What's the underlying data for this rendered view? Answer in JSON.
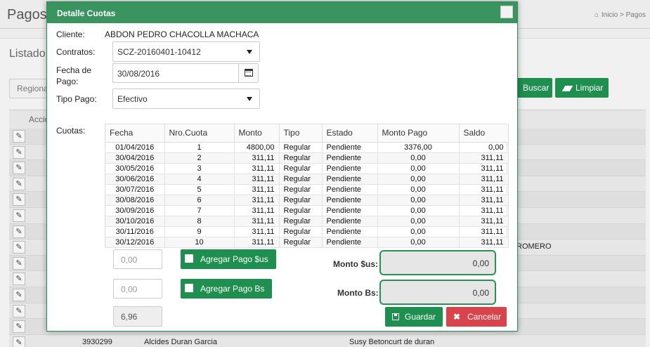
{
  "background": {
    "title": "Pagos",
    "breadcrumb": {
      "home": "Inicio",
      "sep": ">",
      "current": "Pagos"
    },
    "listado": "Listado",
    "region_filter": "Regional",
    "search_label": "Buscar",
    "clear_label": "Limpiar",
    "actions_header": "Acciones",
    "row_right_text": "ROMERO",
    "last_row": {
      "code": "3930299",
      "name": "Alcides Duran Garcia",
      "agent": "Susy Betoncurt de duran"
    }
  },
  "modal": {
    "title": "Detalle Cuotas",
    "client_label": "Cliente:",
    "client_value": "ABDON PEDRO CHACOLLA MACHACA",
    "contract_label": "Contratos:",
    "contract_value": "SCZ-20160401-10412",
    "date_label": "Fecha de Pago:",
    "date_value": "30/08/2016",
    "pay_type_label": "Tipo Pago:",
    "pay_type_value": "Efectivo",
    "quotas_label": "Cuotas:",
    "columns": [
      "Fecha",
      "Nro.Cuota",
      "Monto",
      "Tipo",
      "Estado",
      "Monto Pago",
      "Saldo"
    ],
    "rows": [
      [
        "01/04/2016",
        "1",
        "4800,00",
        "Regular",
        "Pendiente",
        "3376,00",
        "0,00"
      ],
      [
        "30/04/2016",
        "2",
        "311,11",
        "Regular",
        "Pendiente",
        "0,00",
        "311,11"
      ],
      [
        "30/05/2016",
        "3",
        "311,11",
        "Regular",
        "Pendiente",
        "0,00",
        "311,11"
      ],
      [
        "30/06/2016",
        "4",
        "311,11",
        "Regular",
        "Pendiente",
        "0,00",
        "311,11"
      ],
      [
        "30/07/2016",
        "5",
        "311,11",
        "Regular",
        "Pendiente",
        "0,00",
        "311,11"
      ],
      [
        "30/08/2016",
        "6",
        "311,11",
        "Regular",
        "Pendiente",
        "0,00",
        "311,11"
      ],
      [
        "30/09/2016",
        "7",
        "311,11",
        "Regular",
        "Pendiente",
        "0,00",
        "311,11"
      ],
      [
        "30/10/2016",
        "8",
        "311,11",
        "Regular",
        "Pendiente",
        "0,00",
        "311,11"
      ],
      [
        "30/11/2016",
        "9",
        "311,11",
        "Regular",
        "Pendiente",
        "0,00",
        "311,11"
      ],
      [
        "30/12/2016",
        "10",
        "311,11",
        "Regular",
        "Pendiente",
        "0,00",
        "311,11"
      ]
    ],
    "usd_input_placeholder": "0,00",
    "add_usd_label": "Agregar Pago $us",
    "bs_input_placeholder": "0,00",
    "add_bs_label": "Agregar Pago Bs",
    "exchange_rate": "6,96",
    "monto_usd_label": "Monto $us:",
    "monto_usd_value": "0,00",
    "monto_bs_label": "Monto Bs:",
    "monto_bs_value": "0,00",
    "save_label": "Guardar",
    "cancel_label": "Cancelar"
  },
  "colors": {
    "brand_green": "#1e8f4e",
    "header_green": "#3a9460",
    "danger_red": "#d9444c"
  },
  "icons": [
    "home-icon",
    "pencil-icon",
    "calendar-icon",
    "checkbox-icon",
    "save-icon",
    "close-x-icon",
    "eraser-icon"
  ]
}
